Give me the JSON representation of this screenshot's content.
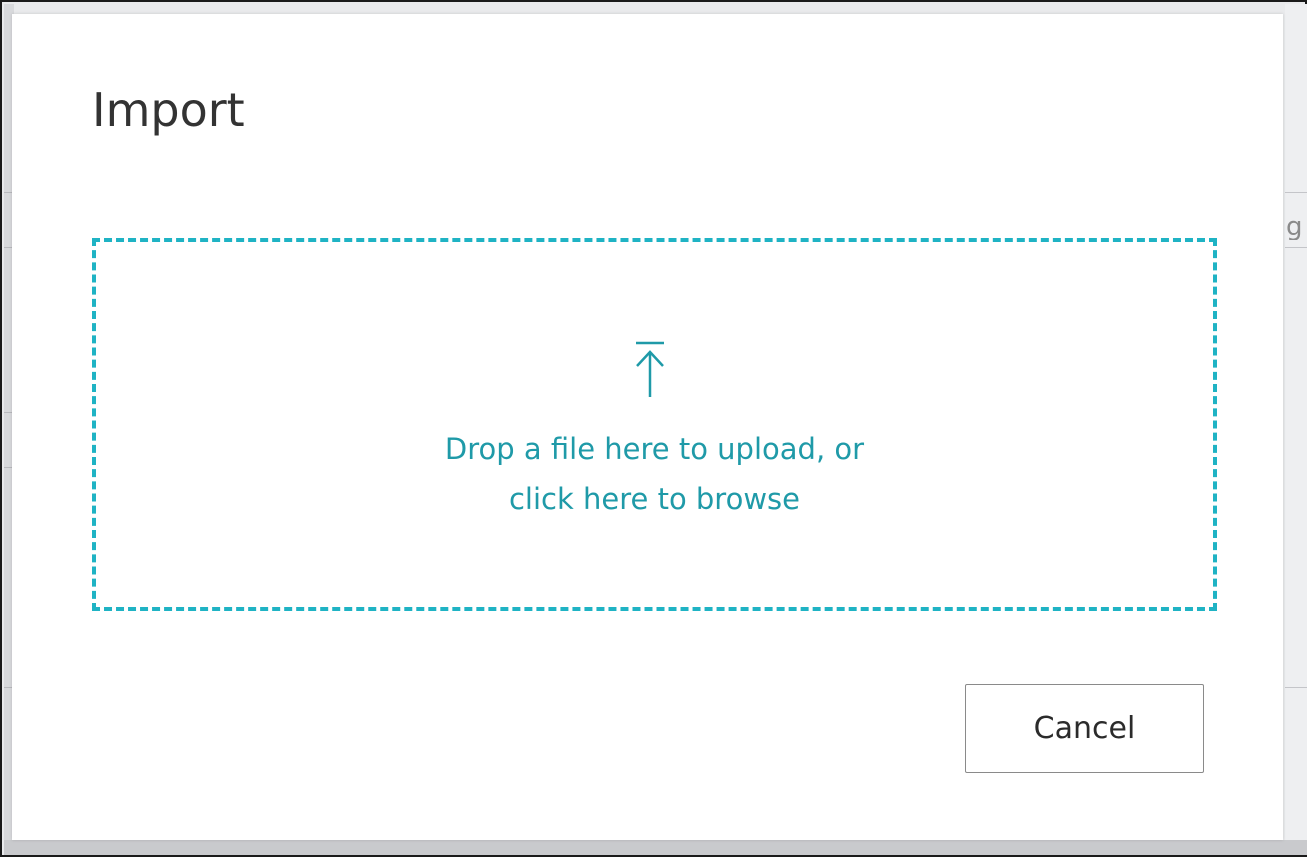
{
  "dialog": {
    "title": "Import",
    "dropzone": {
      "icon": "upload-icon",
      "line1": "Drop a file here to upload, or",
      "line2": "click here to browse"
    },
    "cancel_label": "Cancel"
  },
  "colors": {
    "accent": "#1fb3c4",
    "accent_text": "#1f9aa8",
    "title_text": "#333333",
    "button_border": "#8a8a8a"
  }
}
